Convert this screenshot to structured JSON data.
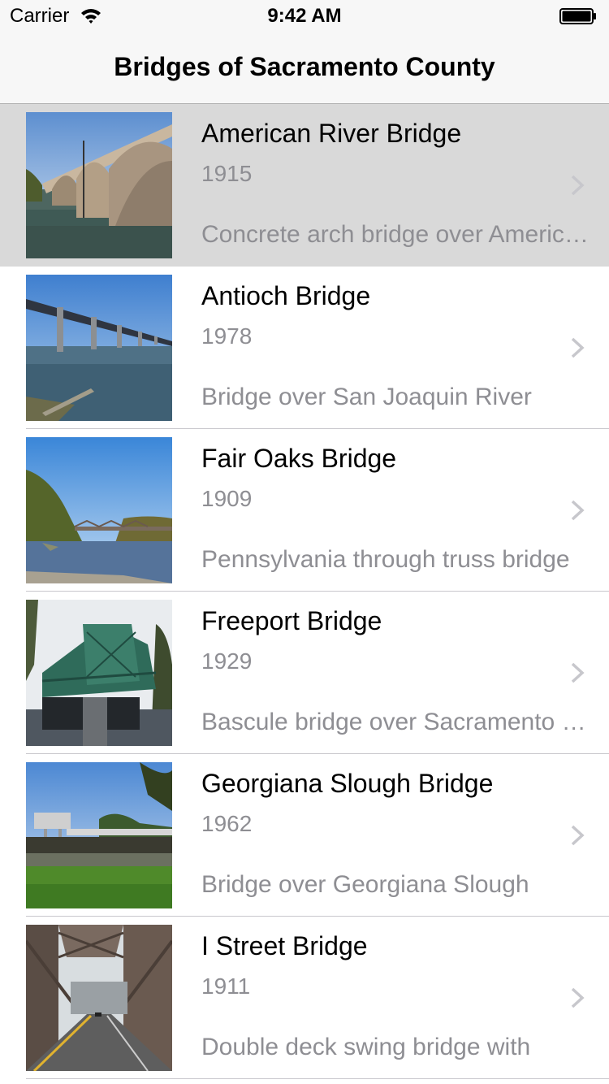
{
  "status_bar": {
    "carrier": "Carrier",
    "time": "9:42 AM"
  },
  "nav": {
    "title": "Bridges of Sacramento County"
  },
  "rows": [
    {
      "title": "American River Bridge",
      "year": "1915",
      "description": "Concrete arch bridge over American River",
      "selected": true,
      "image": "american-river-bridge-photo"
    },
    {
      "title": "Antioch Bridge",
      "year": "1978",
      "description": "Bridge over San Joaquin River",
      "selected": false,
      "image": "antioch-bridge-photo"
    },
    {
      "title": "Fair Oaks Bridge",
      "year": "1909",
      "description": "Pennsylvania through truss bridge",
      "selected": false,
      "image": "fair-oaks-bridge-photo"
    },
    {
      "title": "Freeport Bridge",
      "year": "1929",
      "description": "Bascule bridge over Sacramento River",
      "selected": false,
      "image": "freeport-bridge-photo"
    },
    {
      "title": "Georgiana Slough Bridge",
      "year": "1962",
      "description": "Bridge over Georgiana Slough",
      "selected": false,
      "image": "georgiana-slough-bridge-photo"
    },
    {
      "title": "I Street Bridge",
      "year": "1911",
      "description": "Double deck swing bridge with",
      "selected": false,
      "image": "i-street-bridge-photo"
    }
  ],
  "icons": {
    "wifi": "wifi-icon",
    "battery": "battery-icon",
    "chevron": "chevron-right-icon"
  }
}
